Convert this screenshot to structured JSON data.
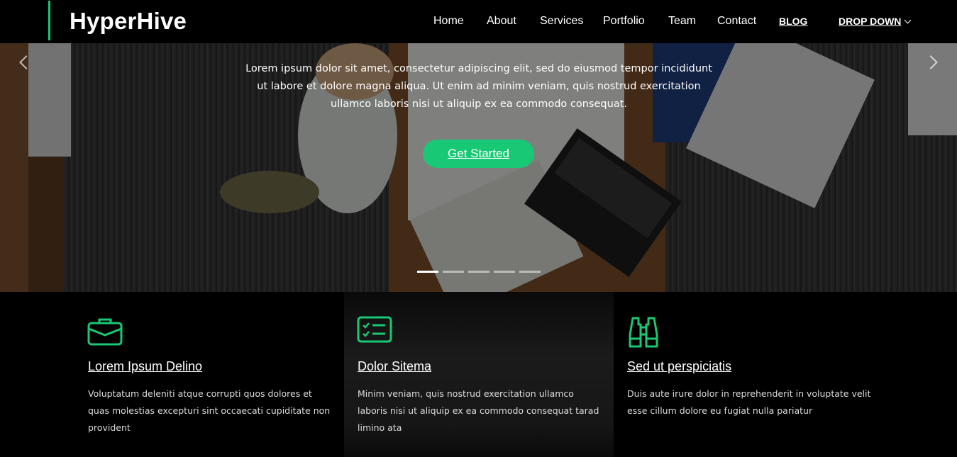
{
  "header": {
    "logo": "HyperHive",
    "nav": [
      {
        "label": "Home",
        "name": "nav-home"
      },
      {
        "label": "About",
        "name": "nav-about"
      },
      {
        "label": "Services",
        "name": "nav-services"
      },
      {
        "label": "Portfolio",
        "name": "nav-portfolio"
      },
      {
        "label": "Team",
        "name": "nav-team"
      },
      {
        "label": "Contact",
        "name": "nav-contact"
      },
      {
        "label": "BLOG",
        "name": "nav-blog"
      },
      {
        "label": "DROP DOWN",
        "name": "nav-dropdown"
      }
    ]
  },
  "hero": {
    "text": "Lorem ipsum dolor sit amet, consectetur adipiscing elit, sed do eiusmod tempor incididunt ut labore et dolore magna aliqua. Ut enim ad minim veniam, quis nostrud exercitation ullamco laboris nisi ut aliquip ex ea commodo consequat.",
    "cta": "Get Started",
    "slide_count": 5,
    "active_slide": 1
  },
  "features": [
    {
      "icon": "briefcase-icon",
      "title": "Lorem Ipsum Delino",
      "desc": "Voluptatum deleniti atque corrupti quos dolores et quas molestias excepturi sint occaecati cupiditate non provident"
    },
    {
      "icon": "checklist-icon",
      "title": "Dolor Sitema",
      "desc": "Minim veniam, quis nostrud exercitation ullamco laboris nisi ut aliquip ex ea commodo consequat tarad limino ata"
    },
    {
      "icon": "binoculars-icon",
      "title": "Sed ut perspiciatis",
      "desc": "Duis aute irure dolor in reprehenderit in voluptate velit esse cillum dolore eu fugiat nulla pariatur"
    }
  ],
  "colors": {
    "accent": "#18c875",
    "background": "#000000"
  }
}
